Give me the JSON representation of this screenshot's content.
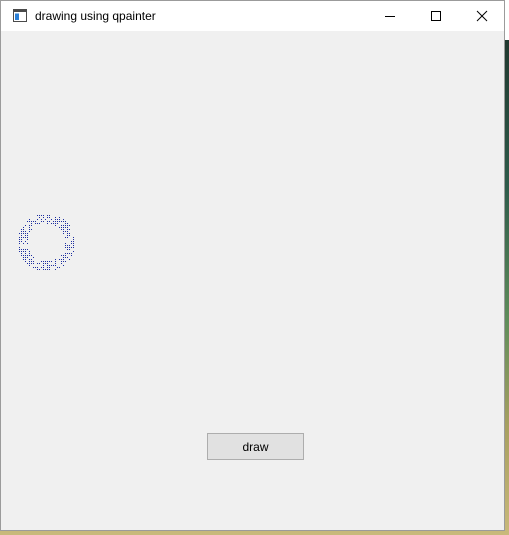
{
  "window": {
    "title": "drawing using qpainter"
  },
  "titlebar_controls": {
    "minimize": "minimize",
    "maximize": "maximize",
    "close": "close"
  },
  "main": {
    "draw_button_label": "draw"
  },
  "colors": {
    "dot_color": "#1e2fa0",
    "window_bg": "#f0f0f0",
    "titlebar_bg": "#ffffff"
  }
}
